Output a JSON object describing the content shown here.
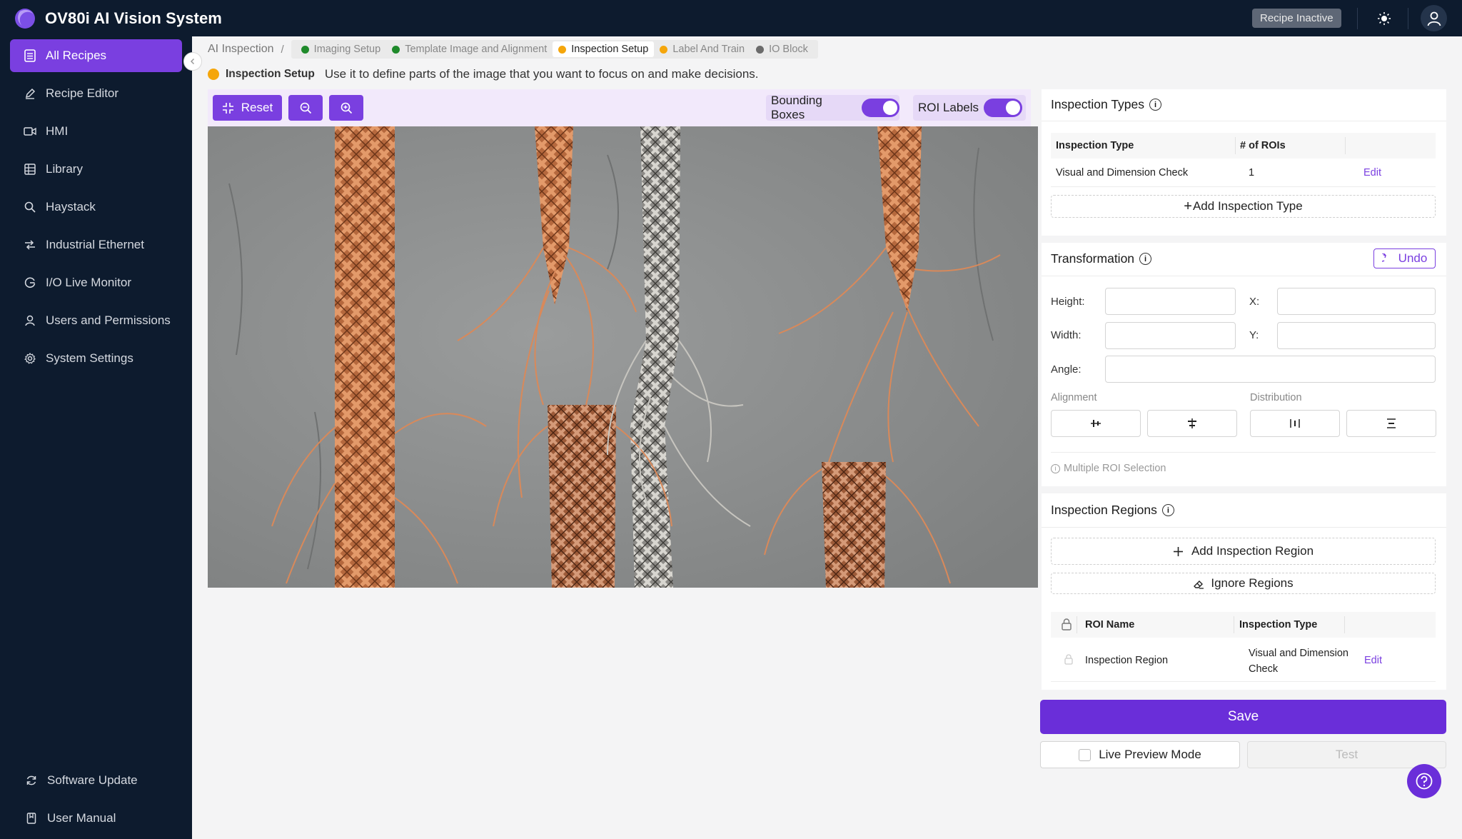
{
  "app": {
    "title": "OV80i AI Vision System",
    "status": "Recipe Inactive"
  },
  "sidebar": {
    "items": [
      {
        "label": "All Recipes",
        "icon": "list-icon"
      },
      {
        "label": "Recipe Editor",
        "icon": "pen-icon"
      },
      {
        "label": "HMI",
        "icon": "video-icon"
      },
      {
        "label": "Library",
        "icon": "table-icon"
      },
      {
        "label": "Haystack",
        "icon": "search-icon"
      },
      {
        "label": "Industrial Ethernet",
        "icon": "ethernet-icon"
      },
      {
        "label": "I/O Live Monitor",
        "icon": "monitor-icon"
      },
      {
        "label": "Users and Permissions",
        "icon": "user-icon"
      },
      {
        "label": "System Settings",
        "icon": "gear-icon"
      }
    ],
    "bottom": [
      {
        "label": "Software Update",
        "icon": "refresh-icon"
      },
      {
        "label": "User Manual",
        "icon": "book-icon"
      }
    ]
  },
  "breadcrumb": {
    "root": "AI Inspection",
    "separator": "/",
    "tabs": [
      {
        "label": "Imaging Setup",
        "color": "#1f8a2b"
      },
      {
        "label": "Template Image and Alignment",
        "color": "#1f8a2b"
      },
      {
        "label": "Inspection Setup",
        "color": "#f5a60b"
      },
      {
        "label": "Label And Train",
        "color": "#f5a60b"
      },
      {
        "label": "IO Block",
        "color": "#6b6b6b"
      }
    ]
  },
  "info": {
    "title": "Inspection Setup",
    "text": "Use it to define parts of the image that you want to focus on and make decisions."
  },
  "toolbar": {
    "reset": "Reset",
    "bounding_boxes": "Bounding Boxes",
    "roi_labels": "ROI Labels"
  },
  "inspection_types": {
    "title": "Inspection Types",
    "columns": [
      "Inspection Type",
      "# of ROIs"
    ],
    "rows": [
      {
        "type": "Visual and Dimension Check",
        "rois": "1",
        "action": "Edit"
      }
    ],
    "add_label": "Add Inspection Type"
  },
  "transformation": {
    "title": "Transformation",
    "undo": "Undo",
    "height": "Height:",
    "width": "Width:",
    "x": "X:",
    "y": "Y:",
    "angle": "Angle:",
    "alignment": "Alignment",
    "distribution": "Distribution",
    "multi_note": "Multiple ROI Selection"
  },
  "inspection_regions": {
    "title": "Inspection Regions",
    "add_label": "Add Inspection Region",
    "ignore_label": "Ignore Regions",
    "columns": [
      "ROI Name",
      "Inspection Type"
    ],
    "rows": [
      {
        "name": "Inspection Region",
        "type": "Visual and Dimension Check",
        "action": "Edit"
      }
    ]
  },
  "actions": {
    "save": "Save",
    "live_preview": "Live Preview Mode",
    "test": "Test"
  },
  "colors": {
    "accent": "#7a3fe0",
    "nav_bg": "#0d1b2e"
  }
}
